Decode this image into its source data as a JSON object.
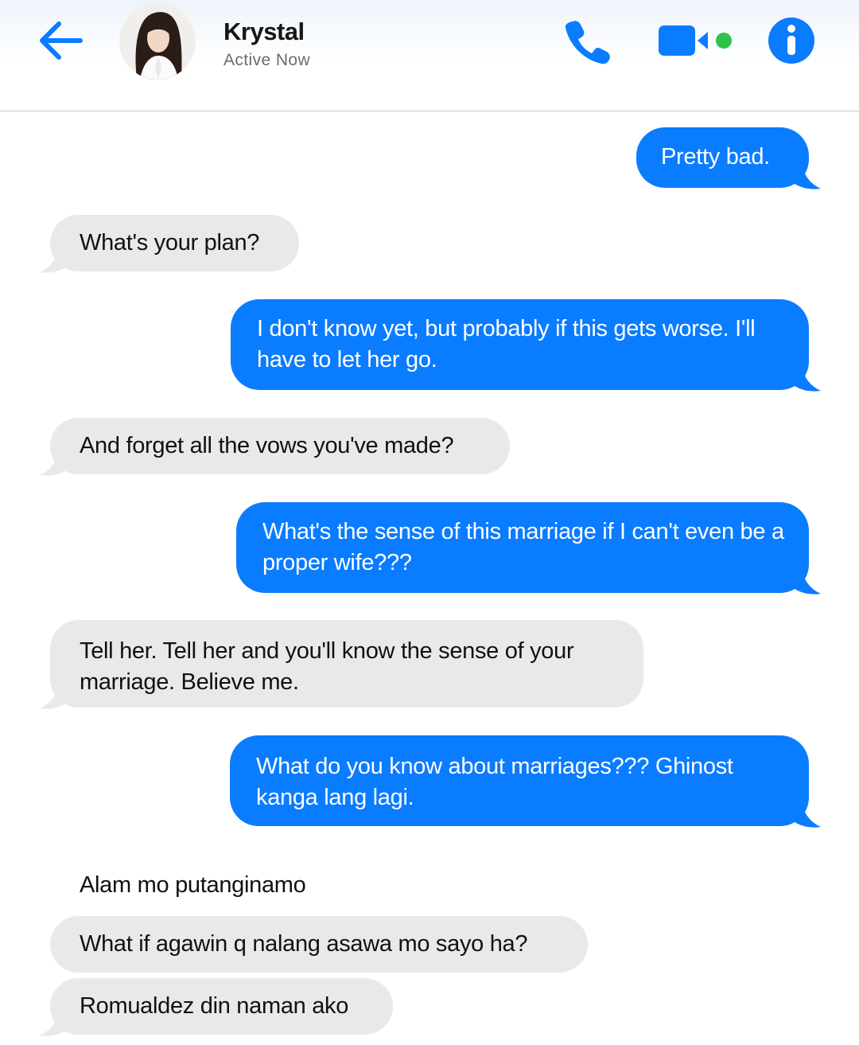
{
  "header": {
    "contact_name": "Krystal",
    "status": "Active Now",
    "icons": {
      "back": "back-arrow-icon",
      "call": "phone-icon",
      "video": "video-camera-icon",
      "info": "info-icon"
    },
    "accent_color": "#0a7cff",
    "online_color": "#31c24d"
  },
  "messages": [
    {
      "from": "me",
      "text": "Pretty bad."
    },
    {
      "from": "them",
      "text": "What's your plan?"
    },
    {
      "from": "me",
      "text": "I don't know yet, but probably if this gets worse. I'll have to let her go."
    },
    {
      "from": "them",
      "text": "And forget all the vows you've made?"
    },
    {
      "from": "me",
      "text": "What's the sense of this marriage if I can't even be a proper wife???"
    },
    {
      "from": "them",
      "text": "Tell her. Tell her and you'll know the sense of your marriage. Believe me."
    },
    {
      "from": "me",
      "text": "What do you know about marriages??? Ghinost kanga lang lagi."
    },
    {
      "from": "them",
      "text": "Alam mo putanginamo"
    },
    {
      "from": "them",
      "text": "What if agawin q nalang asawa mo sayo ha?"
    },
    {
      "from": "them",
      "text": "Romualdez din naman ako"
    }
  ],
  "colors": {
    "outgoing_bubble": "#0a7cff",
    "incoming_bubble": "#e9e9eb"
  }
}
